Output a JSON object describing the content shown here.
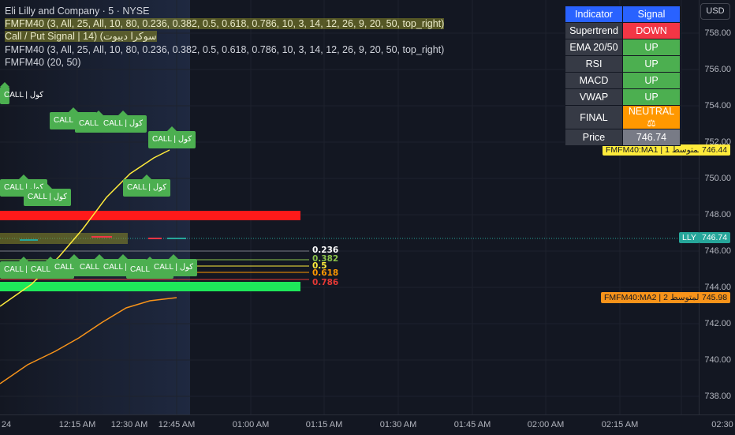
{
  "legend": {
    "title": "Eli Lilly and Company · 5 · NYSE",
    "indicator1": "FMFM40 (3, All, 25, All, 10, 80, 0.236, 0.382, 0.5, 0.618, 0.786, 10, 3, 14, 12, 26, 9, 20, 50, top_right)",
    "indicator2": "Call / Put Signal | 14) (سوکرا دیبوت",
    "indicator3": "FMFM40 (3, All, 25, All, 10, 80, 0.236, 0.382, 0.5, 0.618, 0.786, 10, 3, 14, 12, 26, 9, 20, 50, top_right)",
    "indicator4": "FMFM40 (20, 50)"
  },
  "currency_button": "USD",
  "price_axis": [
    "758.00",
    "756.00",
    "754.00",
    "752.00",
    "750.00",
    "748.00",
    "746.00",
    "744.00",
    "742.00",
    "740.00",
    "738.00"
  ],
  "time_axis": [
    "24",
    "12:15 AM",
    "12:30 AM",
    "12:45 AM",
    "01:00 AM",
    "01:15 AM",
    "01:30 AM",
    "01:45 AM",
    "02:00 AM",
    "02:15 AM",
    "02:30"
  ],
  "tags": {
    "ma1": "FMFM40:MA1 | 1 المتوسط",
    "ma1_value": "746.44",
    "lly": "LLY",
    "lly_value": "746.74",
    "ma2": "FMFM40:MA2 | 2 المتوسط",
    "ma2_value": "745.98"
  },
  "fib_levels": [
    {
      "label": "0.236",
      "color": "#ffffff"
    },
    {
      "label": "0.382",
      "color": "#8bc34a"
    },
    {
      "label": "0.5",
      "color": "#ffeb3b"
    },
    {
      "label": "0.618",
      "color": "#ff9800"
    },
    {
      "label": "0.786",
      "color": "#e53935"
    }
  ],
  "signal_table": {
    "header": [
      "Indicator",
      "Signal"
    ],
    "rows": [
      {
        "name": "Supertrend",
        "signal": "DOWN",
        "color": "#f23645"
      },
      {
        "name": "EMA 20/50",
        "signal": "UP",
        "color": "#4caf50"
      },
      {
        "name": "RSI",
        "signal": "UP",
        "color": "#4caf50"
      },
      {
        "name": "MACD",
        "signal": "UP",
        "color": "#4caf50"
      },
      {
        "name": "VWAP",
        "signal": "UP",
        "color": "#4caf50"
      },
      {
        "name": "FINAL",
        "signal": "NEUTRAL ⚖",
        "color": "#ff9800"
      },
      {
        "name": "Price",
        "signal": "746.74",
        "color": "#787b86"
      }
    ]
  },
  "call_label": "CALL | كول",
  "colors": {
    "background": "#131722",
    "ma1": "#ffeb3b",
    "ma2": "#f7931a",
    "up": "#4caf50",
    "down": "#f23645",
    "bright_green": "#00e676",
    "table_header": "#2962ff"
  }
}
